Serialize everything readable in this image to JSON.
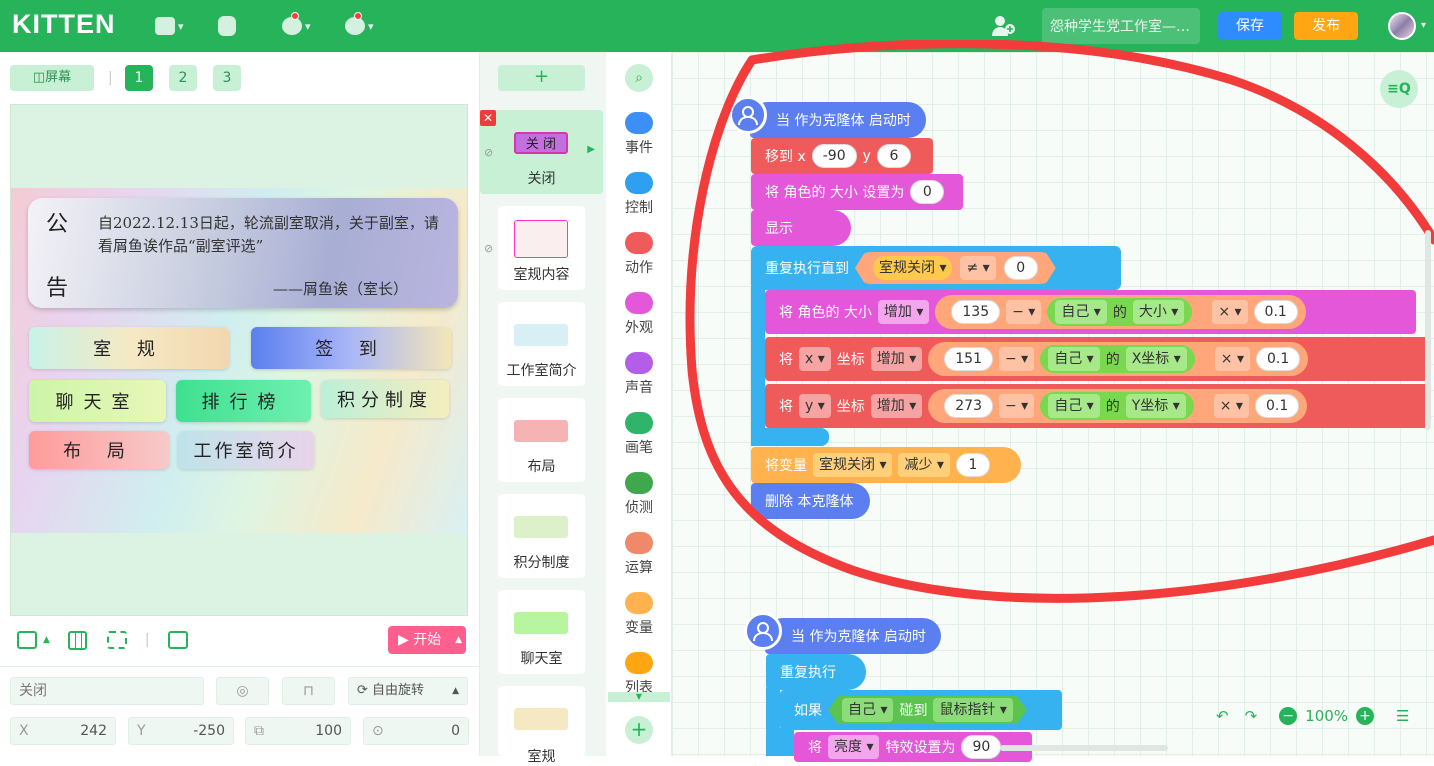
{
  "app": {
    "logo": "KITTEN",
    "work_name": "怨种学生党工作室—…",
    "save": "保存",
    "publish": "发布"
  },
  "stage_bar": {
    "screen_btn": "◫屏幕",
    "pages": [
      "1",
      "2",
      "3"
    ]
  },
  "stage": {
    "notice_char1": "公",
    "notice_char2": "告",
    "notice_text": "自2022.12.13日起，轮流副室取消，关于副室，请看屑鱼诶作品“副室评选”",
    "notice_sign": "——屑鱼诶（室长）",
    "buttons": [
      "室  规",
      "签  到",
      "聊天室",
      "排行榜",
      "积分制度",
      "布  局",
      "工作室简介"
    ]
  },
  "stage_controls": {
    "start": "▶ 开始"
  },
  "props": {
    "name": "关闭",
    "rotate": "自由旋转",
    "x_label": "X",
    "x": "242",
    "y_label": "Y",
    "y": "-250",
    "size": "100",
    "dir": "0"
  },
  "sprites": {
    "add": "+",
    "items": [
      "关闭",
      "室规内容",
      "工作室简介",
      "布局",
      "积分制度",
      "聊天室",
      "室规"
    ]
  },
  "categories": [
    {
      "label": "事件",
      "color": "#3c8ff6"
    },
    {
      "label": "控制",
      "color": "#2f9ff0"
    },
    {
      "label": "动作",
      "color": "#ef5a5a"
    },
    {
      "label": "外观",
      "color": "#e357d8"
    },
    {
      "label": "声音",
      "color": "#b35ee8"
    },
    {
      "label": "画笔",
      "color": "#2fb56a"
    },
    {
      "label": "侦测",
      "color": "#3fa84f"
    },
    {
      "label": "运算",
      "color": "#f0886a"
    },
    {
      "label": "变量",
      "color": "#ffb24d"
    },
    {
      "label": "列表",
      "color": "#ffa612"
    }
  ],
  "script1": {
    "hat": "当 作为克隆体 启动时",
    "move": {
      "label": "移到 x",
      "x": "-90",
      "ylabel": "y",
      "y": "6"
    },
    "setsize": {
      "label": "将 角色的 大小 设置为",
      "val": "0"
    },
    "show": "显示",
    "repeat": {
      "label": "重复执行直到",
      "var": "室规关闭",
      "op": "≠",
      "val": "0"
    },
    "r1": {
      "pre": "将 角色的 大小",
      "dd": "增加",
      "n": "135",
      "op": "−",
      "obj": "自己",
      "of": "的",
      "prop": "大小",
      "mul": "×",
      "k": "0.1"
    },
    "r2": {
      "pre": "将",
      "axis": "x",
      "mid": "坐标",
      "dd": "增加",
      "n": "151",
      "op": "−",
      "obj": "自己",
      "of": "的",
      "prop": "X坐标",
      "mul": "×",
      "k": "0.1"
    },
    "r3": {
      "pre": "将",
      "axis": "y",
      "mid": "坐标",
      "dd": "增加",
      "n": "273",
      "op": "−",
      "obj": "自己",
      "of": "的",
      "prop": "Y坐标",
      "mul": "×",
      "k": "0.1"
    },
    "changevar": {
      "label": "将变量",
      "var": "室规关闭",
      "dd": "减少",
      "val": "1"
    },
    "delete": "删除 本克隆体"
  },
  "script2": {
    "hat": "当 作为克隆体 启动时",
    "forever": "重复执行",
    "if": {
      "label": "如果",
      "obj": "自己",
      "touch": "碰到",
      "target": "鼠标指针"
    },
    "effect": {
      "pre": "将",
      "dd": "亮度",
      "label": "特效设置为",
      "val": "90"
    }
  },
  "zoom": "100%"
}
